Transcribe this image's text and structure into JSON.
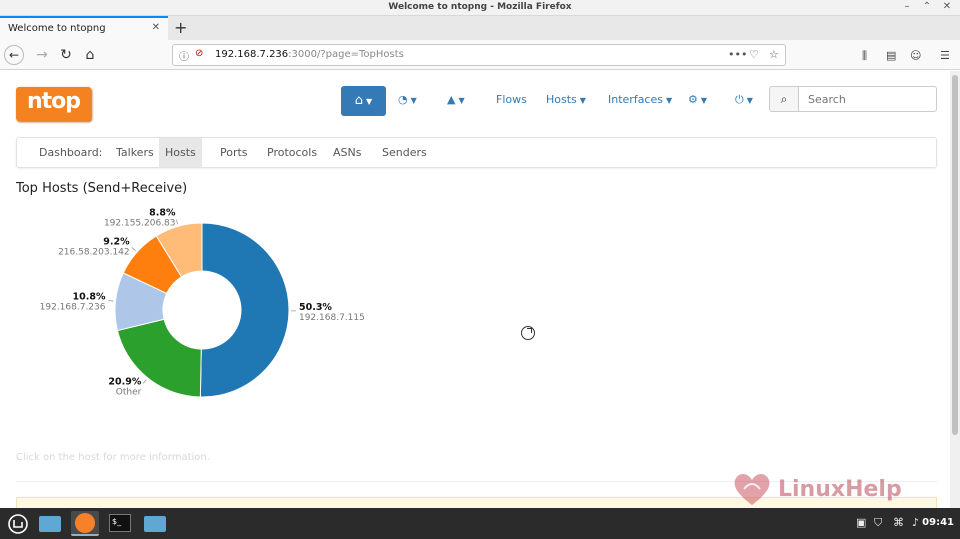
{
  "window": {
    "title": "Welcome to ntopng - Mozilla Firefox"
  },
  "browser": {
    "tab_label": "Welcome to ntopng",
    "url_host": "192.168.7.236",
    "url_path": ":3000/?page=TopHosts",
    "search_placeholder": "Search"
  },
  "app": {
    "logo_text": "ntop",
    "topnav": {
      "flows": "Flows",
      "hosts": "Hosts",
      "interfaces": "Interfaces"
    },
    "subnav": {
      "dashboard": "Dashboard:",
      "talkers": "Talkers",
      "hosts": "Hosts",
      "ports": "Ports",
      "protocols": "Protocols",
      "asns": "ASNs",
      "senders": "Senders"
    },
    "section_title": "Top Hosts (Send+Receive)",
    "hint": "Click on the host for more information."
  },
  "chart_data": {
    "type": "pie",
    "variant": "donut",
    "slices": [
      {
        "label": "192.168.7.115",
        "pct": "50.3%",
        "value": 50.3,
        "color": "#1f77b4"
      },
      {
        "label": "Other",
        "pct": "20.9%",
        "value": 20.9,
        "color": "#2ca02c"
      },
      {
        "label": "192.168.7.236",
        "pct": "10.8%",
        "value": 10.8,
        "color": "#aec7e8"
      },
      {
        "label": "216.58.203.142",
        "pct": "9.2%",
        "value": 9.2,
        "color": "#ff7f0e"
      },
      {
        "label": "192.155.206.83",
        "pct": "8.8%",
        "value": 8.8,
        "color": "#ffbb78"
      }
    ]
  },
  "watermark": {
    "text": "LinuxHelp"
  },
  "taskbar": {
    "clock": "09:41"
  }
}
